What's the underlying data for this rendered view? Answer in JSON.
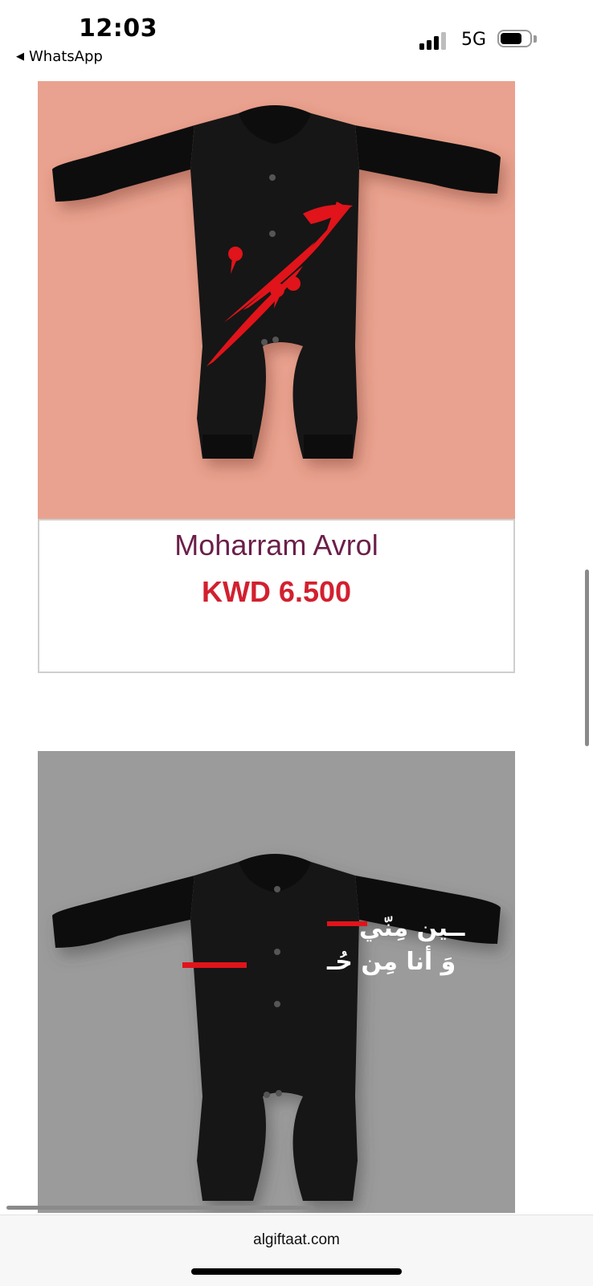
{
  "status_bar": {
    "time": "12:03",
    "back_app": "WhatsApp",
    "back_caret": "◀",
    "network": "5G"
  },
  "products": [
    {
      "name": "Moharram Avrol",
      "price": "KWD 6.500",
      "image_background": "#e9a28f",
      "name_color": "#6b1f49",
      "price_color": "#d2202f"
    },
    {
      "image_background": "#9b9b9b",
      "print_text_line1": "ــين مِنّي",
      "print_text_line2": "وَ أنا مِن حُـ"
    }
  ],
  "browser": {
    "url": "algiftaat.com"
  }
}
